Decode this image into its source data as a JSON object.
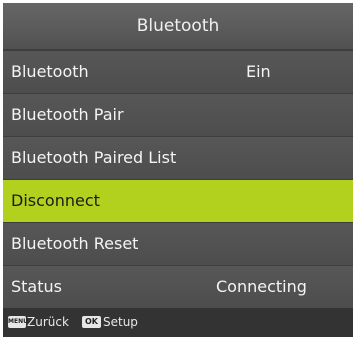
{
  "header": {
    "title": "Bluetooth"
  },
  "menu": {
    "items": [
      {
        "label": "Bluetooth",
        "value": "Ein"
      },
      {
        "label": "Bluetooth Pair"
      },
      {
        "label": "Bluetooth Paired List"
      },
      {
        "label": "Disconnect",
        "selected": true
      },
      {
        "label": "Bluetooth Reset"
      },
      {
        "label": "Status",
        "value": "Connecting"
      }
    ]
  },
  "footer": {
    "menu_key": "MENU",
    "back_label": "Zurück",
    "ok_key": "OK",
    "setup_label": "Setup"
  },
  "colors": {
    "highlight": "#b2d01e",
    "row": "#505050",
    "background": "#3e3e3e"
  }
}
